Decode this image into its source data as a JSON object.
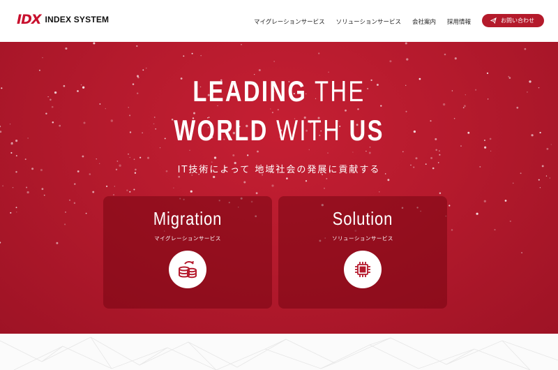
{
  "brand": {
    "mark": "IDX",
    "name": "INDEX SYSTEM",
    "accent": "#c8102e"
  },
  "nav": {
    "items": [
      "マイグレーションサービス",
      "ソリューションサービス",
      "会社案内",
      "採用情報"
    ],
    "contact_label": "お問い合わせ"
  },
  "hero": {
    "headline_line1_bold": "LEADING",
    "headline_line1_light": "THE",
    "headline_line2_bold": "WORLD",
    "headline_line2_light": "WITH",
    "headline_line2_bold2": "US",
    "tagline": "IT技術によって 地域社会の発展に貢献する",
    "background": "#b51a2d"
  },
  "cards": {
    "migration": {
      "title": "Migration",
      "subtitle": "マイグレーションサービス",
      "icon": "database-sync-icon"
    },
    "solution": {
      "title": "Solution",
      "subtitle": "ソリューションサービス",
      "icon": "chip-icon"
    }
  }
}
